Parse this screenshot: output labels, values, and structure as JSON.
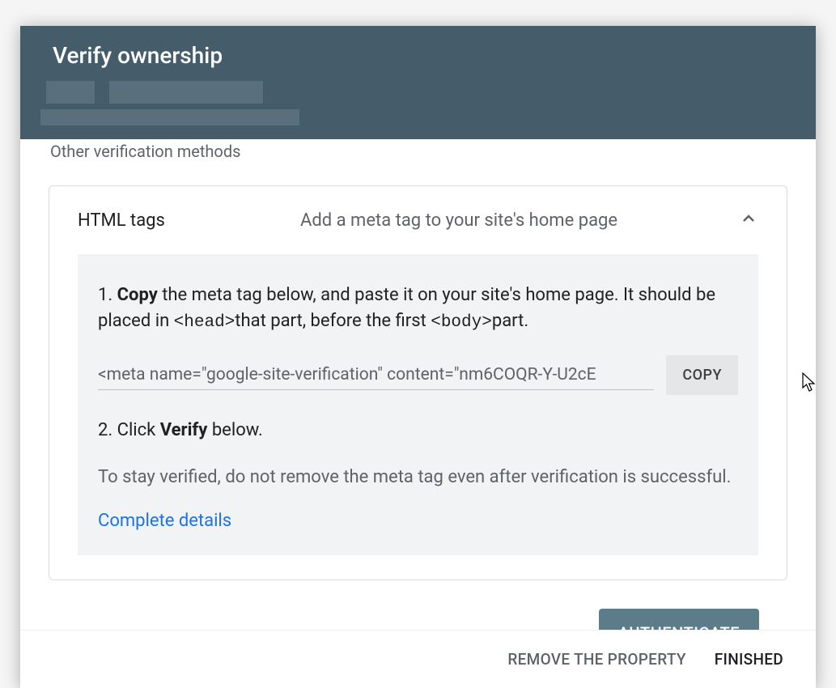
{
  "dialog": {
    "title": "Verify ownership",
    "section_label": "Other verification methods"
  },
  "method": {
    "name": "HTML tags",
    "description": "Add a meta tag to your site's home page",
    "step1_prefix": "1. ",
    "step1_bold": "Copy",
    "step1_text_a": " the meta tag below, and paste it on your site's home page. It should be placed in ",
    "step1_code_a": "<head>",
    "step1_text_b": "that part, before the first ",
    "step1_code_b": "<body>",
    "step1_text_c": "part.",
    "meta_tag_value": "<meta name=\"google-site-verification\" content=\"nm6COQR-Y-U2cE",
    "copy_button": "COPY",
    "step2_prefix": "2. Click ",
    "step2_bold": "Verify",
    "step2_suffix": " below.",
    "note": "To stay verified, do not remove the meta tag even after verification is successful.",
    "details_link": "Complete details",
    "authenticate_button": "AUTHENTICATE"
  },
  "footer": {
    "remove_button": "REMOVE THE PROPERTY",
    "finished_button": "FINISHED"
  }
}
